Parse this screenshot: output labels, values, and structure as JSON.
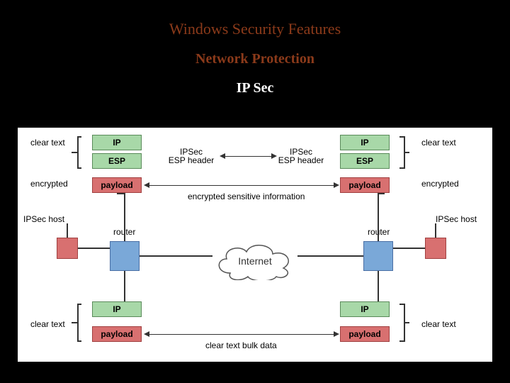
{
  "title": "Windows Security Features",
  "subtitle": "Network Protection",
  "section": "IP Sec",
  "top": {
    "left": {
      "ip": "IP",
      "esp": "ESP",
      "payload": "payload",
      "clear": "clear text",
      "encrypted": "encrypted",
      "host": "IPSec host",
      "router": "router"
    },
    "mid": {
      "ipsec_l": "IPSec\nESP header",
      "ipsec_r": "IPSec\nESP header",
      "encinfo": "encrypted sensitive information"
    },
    "right": {
      "ip": "IP",
      "esp": "ESP",
      "payload": "payload",
      "clear": "clear text",
      "encrypted": "encrypted",
      "host": "IPSec host",
      "router": "router"
    },
    "internet": "Internet"
  },
  "bottom": {
    "left": {
      "ip": "IP",
      "payload": "payload",
      "clear_l": "clear text"
    },
    "right": {
      "ip": "IP",
      "payload": "payload",
      "clear_r": "clear text"
    },
    "bulk": "clear text bulk data"
  },
  "colors": {
    "title": "#8b3a1a",
    "greenBox": "#a8d8a8",
    "redBox": "#d87070",
    "blueBox": "#7aa8d8"
  }
}
